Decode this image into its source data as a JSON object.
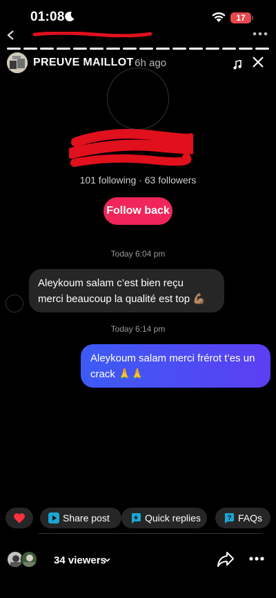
{
  "status_bar": {
    "time": "01:08",
    "battery": "17"
  },
  "header": {
    "username": "PREUVE MAILLOT",
    "ago": "· 6h ago"
  },
  "profile": {
    "counts": "101 following · 63 followers",
    "follow_label": "Follow back"
  },
  "messages": [
    {
      "timestamp": "Today 6:04 pm",
      "direction": "incoming",
      "line1": "Aleykoum salam c’est bien reçu",
      "line2": "merci beaucoup la qualité est top 💪🏽"
    },
    {
      "timestamp": "Today 6:14 pm",
      "direction": "outgoing",
      "line1": "Aleykoum salam merci frérot t’es un",
      "line2": "crack 🙏🙏"
    }
  ],
  "quick_actions": [
    {
      "icon": "heart-icon",
      "label": ""
    },
    {
      "icon": "play-icon",
      "label": "Share post"
    },
    {
      "icon": "lightning-icon",
      "label": "Quick replies"
    },
    {
      "icon": "question-icon",
      "label": "FAQs"
    }
  ],
  "footer": {
    "viewers": "34 viewers"
  },
  "colors": {
    "follow": "#f0265a",
    "outgoing_start": "#3d5bf5",
    "outgoing_end": "#5b3ff2",
    "incoming": "#262626",
    "accent_icon": "#1ba7d6",
    "heart": "#ff3040"
  }
}
